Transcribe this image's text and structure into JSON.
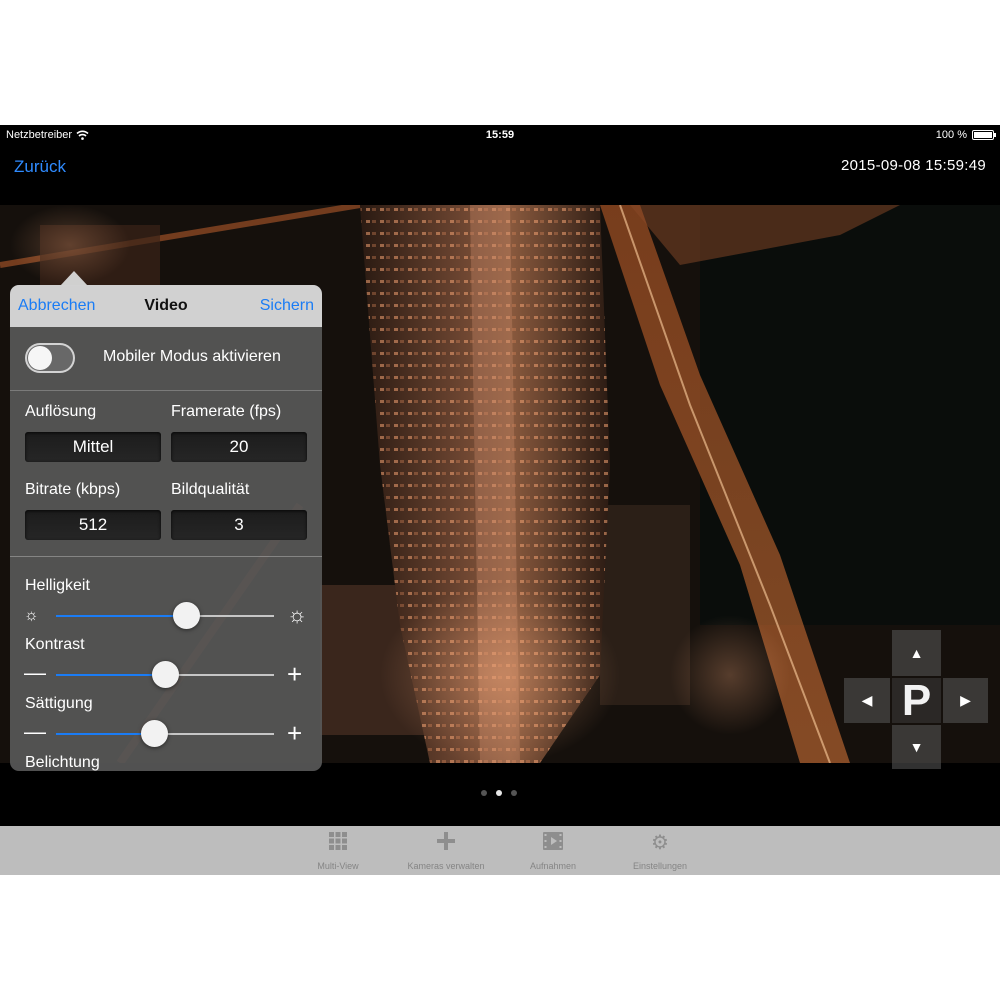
{
  "status_bar": {
    "carrier": "Netzbetreiber",
    "time": "15:59",
    "battery": "100 %",
    "battery_level": 1.0
  },
  "nav": {
    "back_label": "Zurück",
    "timestamp": "2015-09-08 15:59:49"
  },
  "popover": {
    "cancel_label": "Abbrechen",
    "title": "Video",
    "save_label": "Sichern",
    "mobile_mode_label": "Mobiler Modus aktivieren",
    "mobile_mode_on": false,
    "resolution_label": "Auflösung",
    "resolution_value": "Mittel",
    "framerate_label": "Framerate (fps)",
    "framerate_value": "20",
    "bitrate_label": "Bitrate (kbps)",
    "bitrate_value": "512",
    "quality_label": "Bildqualität",
    "quality_value": "3",
    "brightness_label": "Helligkeit",
    "brightness_level": 0.6,
    "contrast_label": "Kontrast",
    "contrast_level": 0.5,
    "saturation_label": "Sättigung",
    "saturation_level": 0.45,
    "exposure_label": "Belichtung"
  },
  "ptz": {
    "center_label": "P",
    "icons": [
      "arrow-up-icon",
      "arrow-left-icon",
      "arrow-right-icon",
      "arrow-down-icon"
    ]
  },
  "page_dots": {
    "count": 3,
    "active_index": 1
  },
  "tabs": [
    {
      "label": "Multi-View",
      "icon": "grid-icon"
    },
    {
      "label": "Kameras verwalten",
      "icon": "plus-icon"
    },
    {
      "label": "Aufnahmen",
      "icon": "film-icon"
    },
    {
      "label": "Einstellungen",
      "icon": "gear-icon"
    }
  ],
  "colors": {
    "accent": "#1a7cf5",
    "nav_link": "#2f8bff",
    "tab_bar": "#bdbdbd"
  }
}
